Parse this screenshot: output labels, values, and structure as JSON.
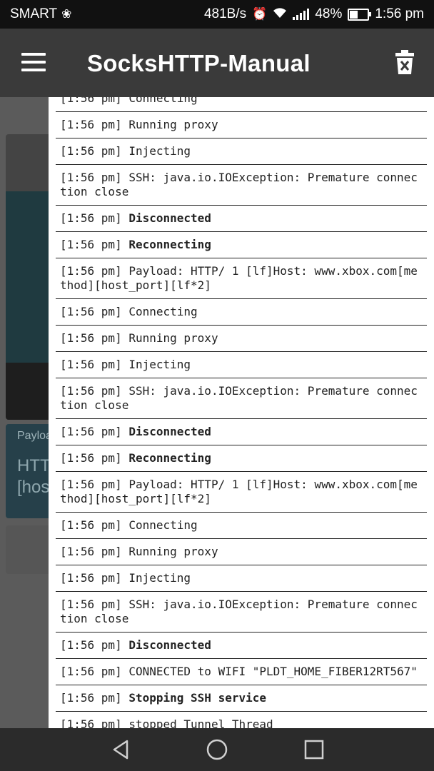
{
  "status_bar": {
    "carrier": "SMART",
    "speed": "481B/s",
    "battery_pct": "48%",
    "battery_level": 0.48,
    "time": "1:56 pm"
  },
  "app_bar": {
    "title": "SocksHTTP-Manual",
    "menu_icon": "hamburger-icon",
    "clear_icon": "delete-log-icon"
  },
  "background": {
    "payload_label": "Payloa",
    "payload_value_line1": "HTT",
    "payload_value_line2": "[hos"
  },
  "log": [
    {
      "time": "[1:56 pm]",
      "text": "Connecting",
      "bold": false
    },
    {
      "time": "[1:56 pm]",
      "text": "Running proxy",
      "bold": false
    },
    {
      "time": "[1:56 pm]",
      "text": "Injecting",
      "bold": false
    },
    {
      "time": "[1:56 pm]",
      "text": "SSH: java.io.IOException: Premature connection close",
      "bold": false
    },
    {
      "time": "[1:56 pm]",
      "text": "Disconnected",
      "bold": true
    },
    {
      "time": "[1:56 pm]",
      "text": "Reconnecting",
      "bold": true
    },
    {
      "time": "[1:56 pm]",
      "text": "Payload: HTTP/ 1 [lf]Host: www.xbox.com[method][host_port][lf*2]",
      "bold": false
    },
    {
      "time": "[1:56 pm]",
      "text": "Connecting",
      "bold": false
    },
    {
      "time": "[1:56 pm]",
      "text": "Running proxy",
      "bold": false
    },
    {
      "time": "[1:56 pm]",
      "text": "Injecting",
      "bold": false
    },
    {
      "time": "[1:56 pm]",
      "text": "SSH: java.io.IOException: Premature connection close",
      "bold": false
    },
    {
      "time": "[1:56 pm]",
      "text": "Disconnected",
      "bold": true
    },
    {
      "time": "[1:56 pm]",
      "text": "Reconnecting",
      "bold": true
    },
    {
      "time": "[1:56 pm]",
      "text": "Payload: HTTP/ 1 [lf]Host: www.xbox.com[method][host_port][lf*2]",
      "bold": false
    },
    {
      "time": "[1:56 pm]",
      "text": "Connecting",
      "bold": false
    },
    {
      "time": "[1:56 pm]",
      "text": "Running proxy",
      "bold": false
    },
    {
      "time": "[1:56 pm]",
      "text": "Injecting",
      "bold": false
    },
    {
      "time": "[1:56 pm]",
      "text": "SSH: java.io.IOException: Premature connection close",
      "bold": false
    },
    {
      "time": "[1:56 pm]",
      "text": "Disconnected",
      "bold": true
    },
    {
      "time": "[1:56 pm]",
      "text": "CONNECTED to WIFI \"PLDT_HOME_FIBER12RT567\"",
      "bold": false
    },
    {
      "time": "[1:56 pm]",
      "text": "Stopping SSH service",
      "bold": true
    },
    {
      "time": "[1:56 pm]",
      "text": "stopped Tunnel Thread",
      "bold": false
    }
  ],
  "nav_bar": {
    "back_icon": "back-triangle-icon",
    "home_icon": "home-circle-icon",
    "recents_icon": "recents-square-icon"
  }
}
